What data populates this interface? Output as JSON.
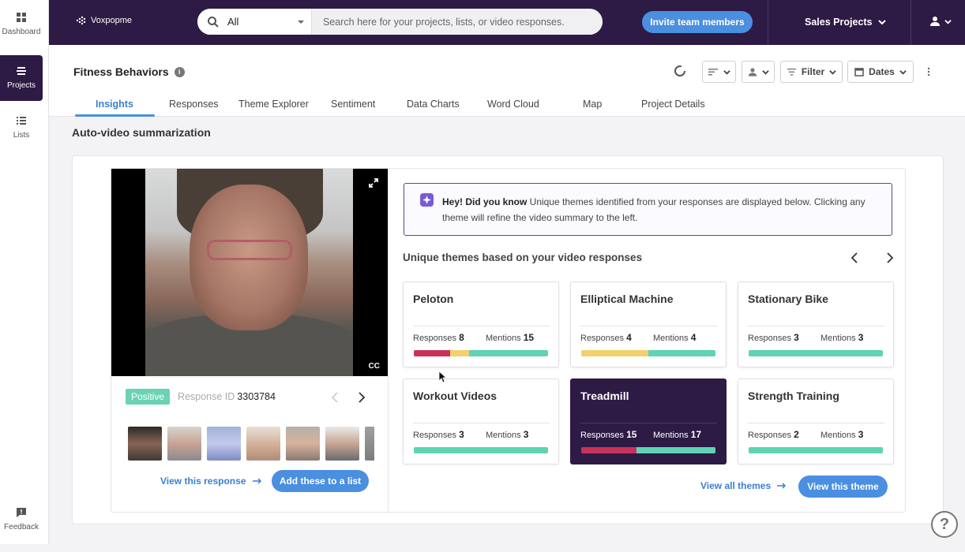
{
  "sidebar": {
    "items": [
      {
        "label": "Dashboard",
        "icon": "dashboard-icon"
      },
      {
        "label": "Projects",
        "icon": "projects-icon",
        "active": true
      },
      {
        "label": "Lists",
        "icon": "lists-icon"
      }
    ],
    "feedback_label": "Feedback"
  },
  "topbar": {
    "logo_text": "Voxpopme",
    "search": {
      "scope": "All",
      "placeholder": "Search here for your projects, lists, or video responses."
    },
    "invite_label": "Invite team members",
    "project_selector": "Sales Projects"
  },
  "header": {
    "title": "Fitness Behaviors",
    "filter_label": "Filter",
    "dates_label": "Dates",
    "tabs": [
      "Insights",
      "Responses",
      "Theme Explorer",
      "Sentiment",
      "Data Charts",
      "Word Cloud",
      "Map",
      "Project Details"
    ],
    "active_tab": "Insights"
  },
  "main": {
    "section_title": "Auto-video summarization",
    "video": {
      "cc_label": "CC",
      "sentiment": "Positive",
      "response_id_label": "Response ID",
      "response_id": "3303784",
      "view_response_label": "View this response",
      "add_to_list_label": "Add these to a list"
    },
    "tip": {
      "bold": "Hey! Did you know",
      "text": " Unique themes identified from your responses are displayed below. Clicking any theme will refine the video summary to the left."
    },
    "themes_title": "Unique themes based on your video responses",
    "responses_label": "Responses",
    "mentions_label": "Mentions",
    "themes": [
      {
        "name": "Peloton",
        "responses": "8",
        "mentions": "15",
        "sentiment": [
          0.27,
          0.14,
          0.59
        ]
      },
      {
        "name": "Elliptical Machine",
        "responses": "4",
        "mentions": "4",
        "sentiment": [
          0,
          0.5,
          0.5
        ]
      },
      {
        "name": "Stationary Bike",
        "responses": "3",
        "mentions": "3",
        "sentiment": [
          0,
          0,
          1
        ]
      },
      {
        "name": "Workout Videos",
        "responses": "3",
        "mentions": "3",
        "sentiment": [
          0,
          0,
          1
        ]
      },
      {
        "name": "Treadmill",
        "responses": "15",
        "mentions": "17",
        "sentiment": [
          0.41,
          0,
          0.59
        ],
        "selected": true
      },
      {
        "name": "Strength Training",
        "responses": "2",
        "mentions": "3",
        "sentiment": [
          0,
          0,
          1
        ]
      }
    ],
    "view_all_themes_label": "View all themes",
    "view_theme_label": "View this theme"
  },
  "colors": {
    "brand_dark": "#2d1a45",
    "accent_blue": "#4a8fe0",
    "negative": "#c8325a",
    "neutral": "#f2d06b",
    "positive": "#5fd3b3"
  }
}
